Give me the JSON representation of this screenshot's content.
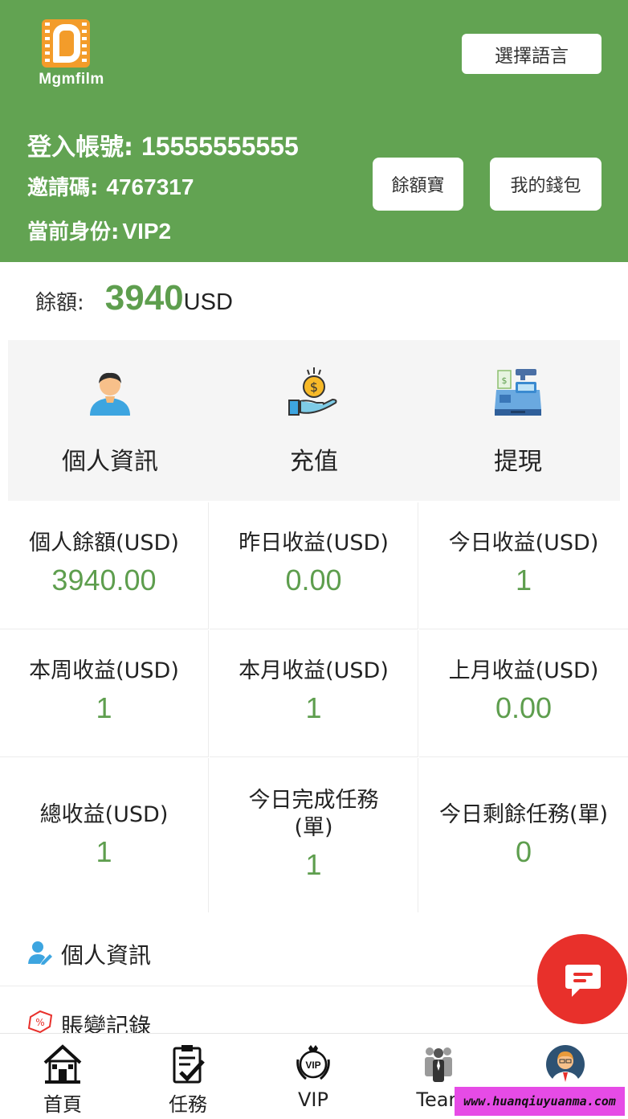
{
  "header": {
    "brand": "Mgmfilm",
    "language_button": "選擇語言",
    "account_label": "登入帳號:",
    "account_value": "15555555555",
    "invite_label": "邀請碼:",
    "invite_value": "4767317",
    "identity_label": "當前身份:",
    "identity_value": "VIP2",
    "yuebao_button": "餘額寶",
    "wallet_button": "我的錢包",
    "accent_color": "#62a352"
  },
  "balance": {
    "label": "餘額:",
    "value": "3940",
    "unit": "USD"
  },
  "quick_actions": [
    {
      "label": "個人資訊",
      "icon": "user-avatar-icon"
    },
    {
      "label": "充值",
      "icon": "coin-hand-icon"
    },
    {
      "label": "提現",
      "icon": "cash-register-icon"
    }
  ],
  "stats": [
    {
      "label": "個人餘額(USD)",
      "value": "3940.00"
    },
    {
      "label": "昨日收益(USD)",
      "value": "0.00"
    },
    {
      "label": "今日收益(USD)",
      "value": "1"
    },
    {
      "label": "本周收益(USD)",
      "value": "1"
    },
    {
      "label": "本月收益(USD)",
      "value": "1"
    },
    {
      "label": "上月收益(USD)",
      "value": "0.00"
    },
    {
      "label": "總收益(USD)",
      "value": "1"
    },
    {
      "label": "今日完成任務(單)",
      "value": "1"
    },
    {
      "label": "今日剩餘任務(單)",
      "value": "0"
    }
  ],
  "list": [
    {
      "label": "個人資訊",
      "icon": "user-edit-icon"
    },
    {
      "label": "賬變記錄",
      "icon": "discount-tag-icon"
    }
  ],
  "bottom_nav": [
    {
      "label": "首頁",
      "icon": "home-icon"
    },
    {
      "label": "任務",
      "icon": "task-clipboard-icon"
    },
    {
      "label": "VIP",
      "icon": "vip-badge-icon"
    },
    {
      "label": "Tean",
      "icon": "team-icon"
    },
    {
      "label": "",
      "icon": "profile-avatar-icon"
    }
  ],
  "watermark": "www.huanqiuyuanma.com"
}
